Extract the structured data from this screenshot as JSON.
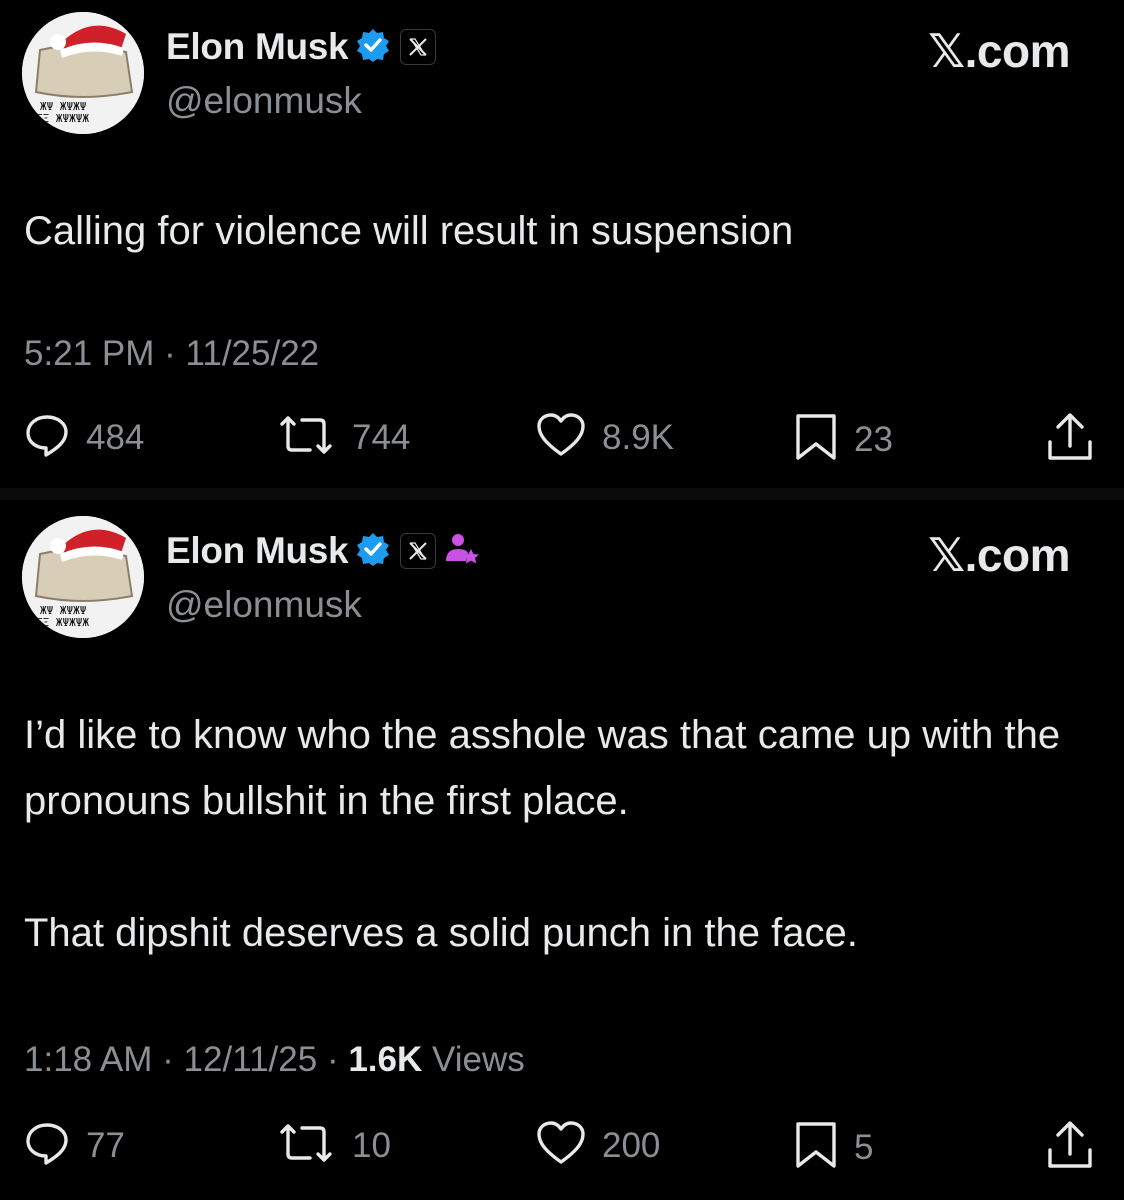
{
  "tweets": [
    {
      "author": {
        "name": "Elon Musk",
        "handle": "@elonmusk",
        "verified_icon": "verified-badge-icon",
        "affiliate_icon": "x-logo-icon"
      },
      "brand": "𝕏.com",
      "text": [
        "Calling for violence will result in suspension"
      ],
      "meta": {
        "time": "5:21 PM",
        "date": "11/25/22"
      },
      "stats": {
        "replies": "484",
        "reposts": "744",
        "likes": "8.9K",
        "bookmarks": "23"
      }
    },
    {
      "author": {
        "name": "Elon Musk",
        "handle": "@elonmusk",
        "verified_icon": "verified-badge-icon",
        "affiliate_icon": "x-logo-icon",
        "extra_icon": "person-star-icon"
      },
      "brand": "𝕏.com",
      "text": [
        "I’d like to know who the asshole was that came up with the pronouns bullshit in the first place.",
        "That dipshit deserves a solid punch in the face."
      ],
      "meta": {
        "time": "1:18 AM",
        "date": "12/11/25",
        "views_count": "1.6K",
        "views_label": "Views"
      },
      "stats": {
        "replies": "77",
        "reposts": "10",
        "likes": "200",
        "bookmarks": "5"
      }
    }
  ],
  "colors": {
    "background": "#000000",
    "text": "#e7e9ea",
    "muted": "#8b8f94",
    "verified": "#1d9bf0",
    "accent_purple": "#c951e6"
  }
}
